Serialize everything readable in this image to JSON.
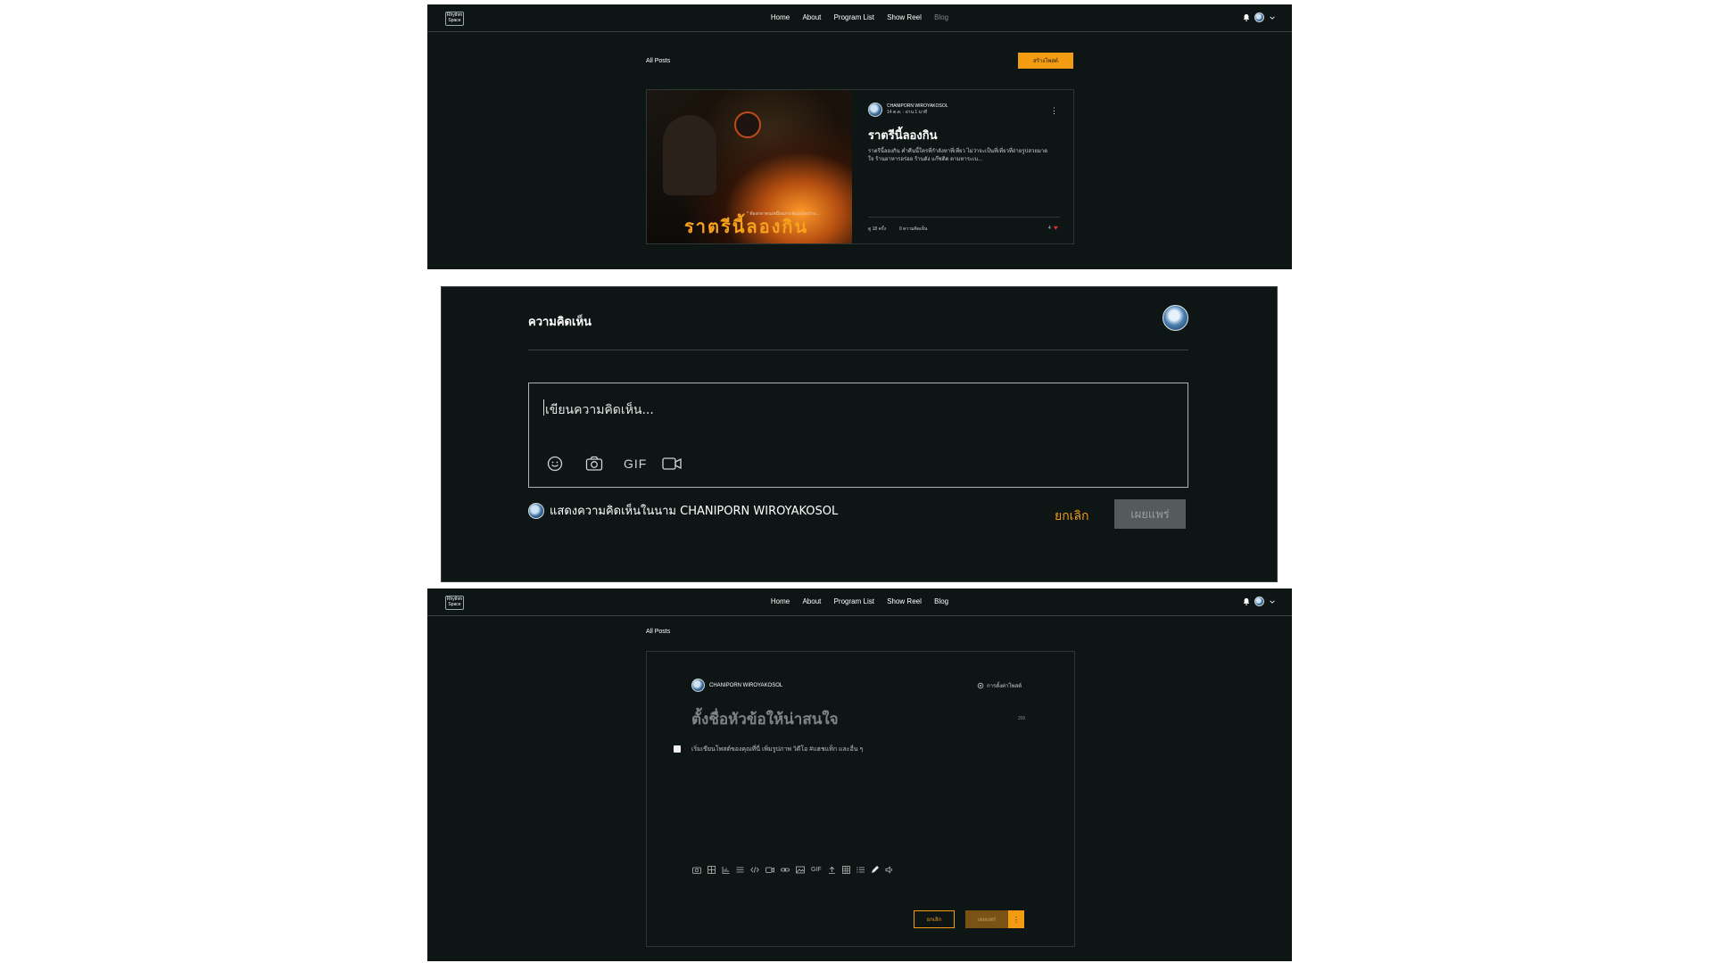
{
  "nav": {
    "logo_text": "Rhythm Space",
    "links": [
      "Home",
      "About",
      "Program List",
      "Show Reel",
      "Blog"
    ]
  },
  "blog_list": {
    "all_posts_label": "All Posts",
    "create_post_button": "สร้างโพสต์",
    "post": {
      "author": "CHANIPORN WIROYAKOSOL",
      "meta": "14 ต.ค. · อ่าน 1 นาที",
      "title": "ราตรีนี้ลองกิน",
      "excerpt": "ราตรีนี้ลองกิน ค่ำคืนนี้ใครที่กำลังหาที่เที่ยว ไม่ว่าจะเป็นที่เที่ยวที่ถ่ายรูปสวยมาดใจ ร้านอาหารอร่อย ร้านดัง แก๊ซติด ตามหาระเบ...",
      "views": "ดู 18 ครั้ง",
      "comments": "0 ความคิดเห็น",
      "likes": "4",
      "image_title": "ราตรีนี้ลองกิน",
      "image_caption": "* ต้องกลาคนเหมือนกระตุ้นแปลงร่าง..."
    }
  },
  "comments": {
    "title": "ความคิดเห็น",
    "placeholder": "เขียนความคิดเห็น...",
    "toolbar": {
      "gif": "GIF"
    },
    "comment_as": "แสดงความคิดเห็นในนาม CHANIPORN WIROYAKOSOL",
    "cancel": "ยกเลิก",
    "publish": "เผยแพร่"
  },
  "post_editor": {
    "all_posts_label": "All Posts",
    "author": "CHANIPORN WIROYAKOSOL",
    "settings_label": "การตั้งค่าโพสต์",
    "title_placeholder": "ตั้งชื่อหัวข้อให้น่าสนใจ",
    "char_count": "200",
    "body_placeholder": "เริ่มเขียนโพสต์ของคุณที่นี่ เพิ่มรูปภาพ วิดีโอ #แฮชแท็ก และอื่น ๆ",
    "gif_label": "GIF",
    "cancel": "ยกเลิก",
    "publish": "เผยแพร่"
  },
  "colors": {
    "background": "#0e1515",
    "accent": "#f39c12",
    "text": "#ffffff"
  }
}
